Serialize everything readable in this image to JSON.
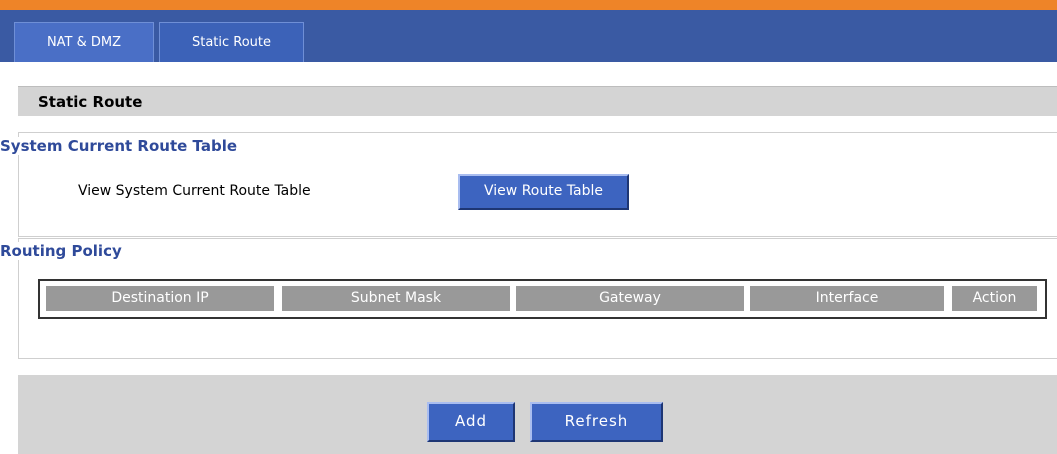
{
  "tabs": [
    {
      "label": "NAT & DMZ"
    },
    {
      "label": "Static Route"
    }
  ],
  "section_title": "Static Route",
  "route_table_group": {
    "title": "System Current Route Table",
    "label": "View System Current Route Table",
    "button_label": "View Route Table"
  },
  "routing_policy": {
    "title": "Routing Policy",
    "columns": [
      "Destination IP",
      "Subnet Mask",
      "Gateway",
      "Interface",
      "Action"
    ]
  },
  "actions": {
    "add_label": "Add",
    "refresh_label": "Refresh"
  },
  "colors": {
    "accent_orange": "#ee8428",
    "tab_bar": "#3a5aa3",
    "button_blue": "#3d64c0",
    "group_title": "#2f4a9a",
    "header_gray": "#999999"
  }
}
